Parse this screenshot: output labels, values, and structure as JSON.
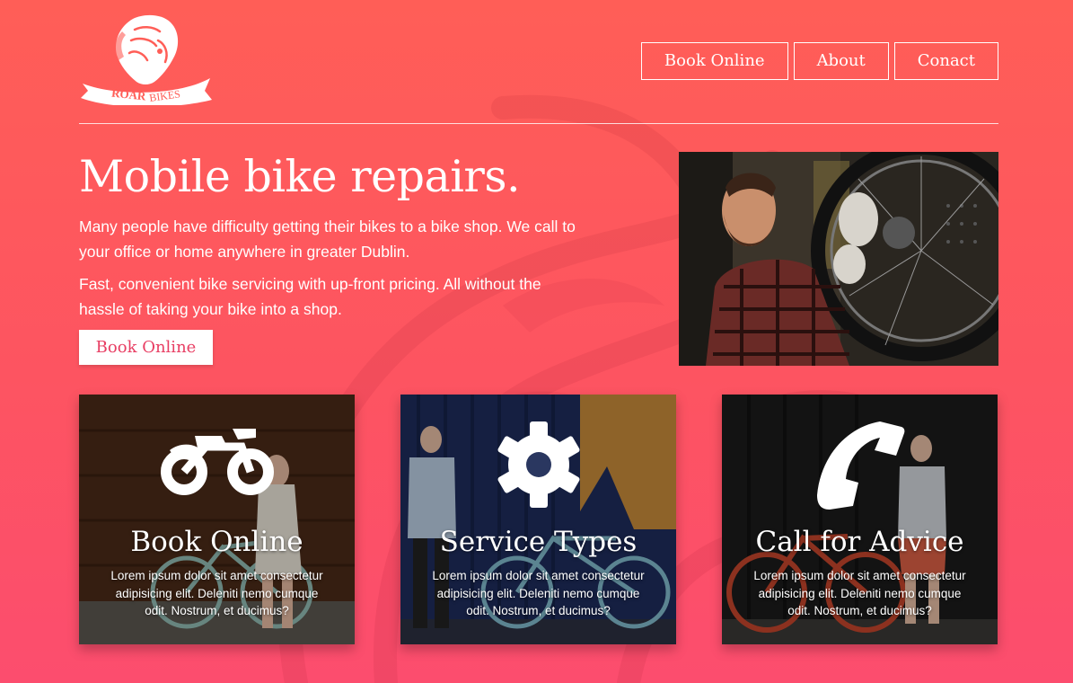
{
  "brand": {
    "name": "ROAR BIKES",
    "logo_icon": "lion-head-icon"
  },
  "nav": {
    "items": [
      {
        "label": "Book Online"
      },
      {
        "label": "About"
      },
      {
        "label": "Conact"
      }
    ]
  },
  "hero": {
    "title": "Mobile bike repairs.",
    "paragraphs": [
      "Many people have difficulty getting their bikes to a bike shop. We call to your office or home anywhere in greater Dublin.",
      "Fast, convenient bike servicing with up-front pricing. All without the hassle of taking your bike into a shop."
    ],
    "cta_label": "Book Online"
  },
  "cards": [
    {
      "title": "Book Online",
      "icon": "motorcycle-icon",
      "text": "Lorem ipsum dolor sit amet consectetur adipisicing elit. Deleniti nemo cumque odit. Nostrum, et ducimus?"
    },
    {
      "title": "Service Types",
      "icon": "gear-icon",
      "text": "Lorem ipsum dolor sit amet consectetur adipisicing elit. Deleniti nemo cumque odit. Nostrum, et ducimus?"
    },
    {
      "title": "Call for Advice",
      "icon": "phone-icon",
      "text": "Lorem ipsum dolor sit amet consectetur adipisicing elit. Deleniti nemo cumque odit. Nostrum, et ducimus?"
    }
  ],
  "colors": {
    "accent": "#e83e63",
    "background_top": "#ff5e57",
    "background_bottom": "#fc4d6e"
  }
}
